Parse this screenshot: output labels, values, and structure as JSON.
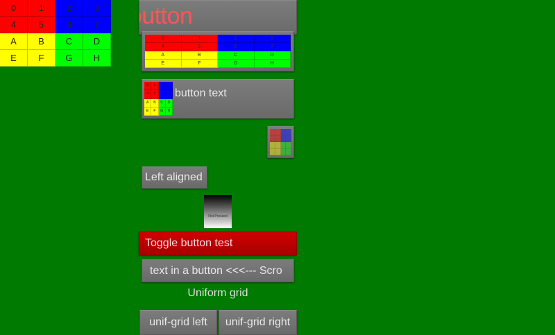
{
  "top_left_grid": {
    "cells": [
      "0",
      "1",
      "2",
      "3",
      "4",
      "5",
      "6",
      "7",
      "A",
      "B",
      "C",
      "D",
      "E",
      "F",
      "G",
      "H"
    ],
    "colors": [
      "#ff0000",
      "#0000ff",
      "#ffff00",
      "#00ff00"
    ]
  },
  "image_only_button": {
    "label": "nly button"
  },
  "image_text_button": {
    "label": "button text"
  },
  "left_aligned_button": {
    "label": "Left aligned"
  },
  "not_pressed_button": {
    "label": "Not Pressed"
  },
  "toggle_button": {
    "label": "Toggle button test"
  },
  "scroll_text_button": {
    "label": "text in a button <<<--- Scro"
  },
  "uniform_grid": {
    "title": "Uniform grid",
    "left_label": "unif-grid left",
    "right_label": "unif-grid right"
  },
  "background_color": "#007a00"
}
